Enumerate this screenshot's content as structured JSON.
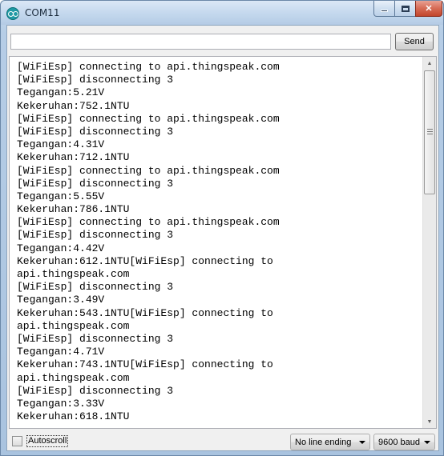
{
  "window": {
    "title": "COM11",
    "app_icon": "arduino-icon",
    "accent": "#1f9aa5",
    "close_color": "#c2452c"
  },
  "input": {
    "value": "",
    "send_label": "Send"
  },
  "output": {
    "lines": [
      "[WiFiEsp] connecting to api.thingspeak.com",
      "[WiFiEsp] disconnecting 3",
      "Tegangan:5.21V",
      "Kekeruhan:752.1NTU",
      "[WiFiEsp] connecting to api.thingspeak.com",
      "[WiFiEsp] disconnecting 3",
      "Tegangan:4.31V",
      "Kekeruhan:712.1NTU",
      "[WiFiEsp] connecting to api.thingspeak.com",
      "[WiFiEsp] disconnecting 3",
      "Tegangan:5.55V",
      "Kekeruhan:786.1NTU",
      "[WiFiEsp] connecting to api.thingspeak.com",
      "[WiFiEsp] disconnecting 3",
      "Tegangan:4.42V",
      "Kekeruhan:612.1NTU[WiFiEsp] connecting to",
      "api.thingspeak.com",
      "[WiFiEsp] disconnecting 3",
      "Tegangan:3.49V",
      "Kekeruhan:543.1NTU[WiFiEsp] connecting to",
      "api.thingspeak.com",
      "[WiFiEsp] disconnecting 3",
      "Tegangan:4.71V",
      "Kekeruhan:743.1NTU[WiFiEsp] connecting to",
      "api.thingspeak.com",
      "[WiFiEsp] disconnecting 3",
      "Tegangan:3.33V",
      "Kekeruhan:618.1NTU"
    ],
    "scroll_position": 0
  },
  "footer": {
    "autoscroll_label": "Autoscroll",
    "autoscroll_checked": false,
    "line_ending": "No line ending",
    "baud_rate": "9600 baud"
  }
}
